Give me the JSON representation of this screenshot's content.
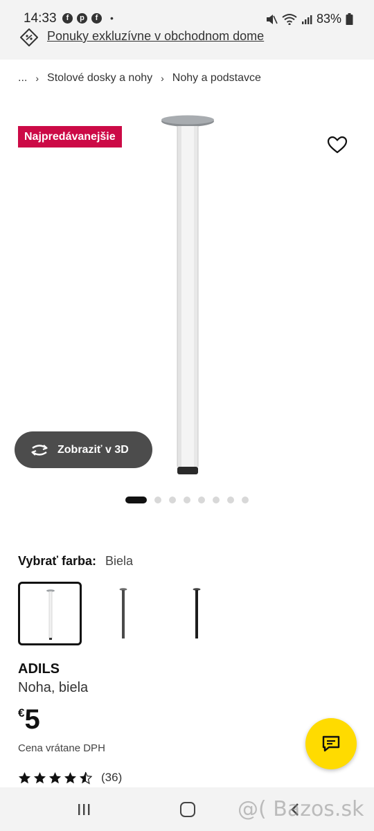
{
  "status_bar": {
    "time": "14:33",
    "app_icons": [
      "facebook-icon",
      "pinterest-icon",
      "facebook-icon"
    ],
    "more_indicator": "•",
    "battery": "83%"
  },
  "promo": {
    "text": "Ponuky exkluzívne v obchodnom dome"
  },
  "breadcrumb": {
    "items": [
      "...",
      "Stolové dosky a nohy",
      "Nohy a podstavce"
    ]
  },
  "product_image": {
    "badge": "Najpredávanejšie",
    "view3d_label": "Zobraziť v 3D",
    "carousel_total": 9,
    "carousel_active": 1
  },
  "color_select": {
    "label": "Vybrať farba:",
    "value": "Biela",
    "options": [
      "white",
      "dark-grey",
      "black"
    ],
    "selected_index": 0
  },
  "product": {
    "name": "ADILS",
    "description": "Noha, biela",
    "price_currency": "€",
    "price_value": "5",
    "vat_note": "Cena vrátane DPH",
    "rating_stars": 4.5,
    "rating_count": "(36)"
  },
  "watermark": "@( Bazos.sk",
  "colors": {
    "badge": "#cc0a46",
    "chat_fab": "#ffdb00",
    "view3d_button": "#4c4c4c"
  }
}
